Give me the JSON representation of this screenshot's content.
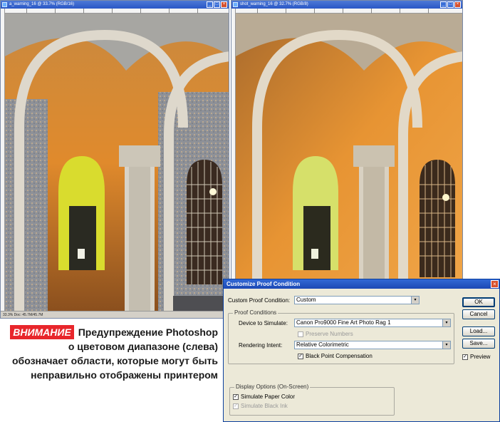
{
  "left_window": {
    "title": "a_warning_16 @ 33.7% (RGB/16)",
    "status": "33.3%    Doc: 45.7M/45.7M"
  },
  "right_window": {
    "title": "shot_warning_16 @ 32.7% (RGB/8)"
  },
  "dialog": {
    "title": "Customize Proof Condition",
    "close_glyph": "×",
    "custom_label": "Custom Proof Condition:",
    "custom_value": "Custom",
    "proof_group_title": "Proof Conditions",
    "device_label": "Device to Simulate:",
    "device_value": "Canon Pro9000 Fine Art Photo Rag 1",
    "preserve_label": "Preserve Numbers",
    "intent_label": "Rendering Intent:",
    "intent_value": "Relative Colorimetric",
    "black_point_label": "Black Point Compensation",
    "display_group_title": "Display Options (On-Screen)",
    "paper_label": "Simulate Paper Color",
    "ink_label": "Simulate Black Ink",
    "ok": "OK",
    "cancel": "Cancel",
    "load": "Load...",
    "save": "Save...",
    "preview_label": "Preview",
    "checked_glyph": "✓",
    "dropdown_glyph": "▾"
  },
  "caption": {
    "badge": "ВНИМАНИЕ",
    "text": "Предупреждение Photoshop о цветовом диапазоне (слева) обозначает области, которые могут быть неправильно отображены принтером"
  },
  "colors": {
    "warning_gray": "#8c8f95",
    "warm_orange": "#e58a2a",
    "stone": "#ddd8cc",
    "badge_red": "#e8262b"
  }
}
